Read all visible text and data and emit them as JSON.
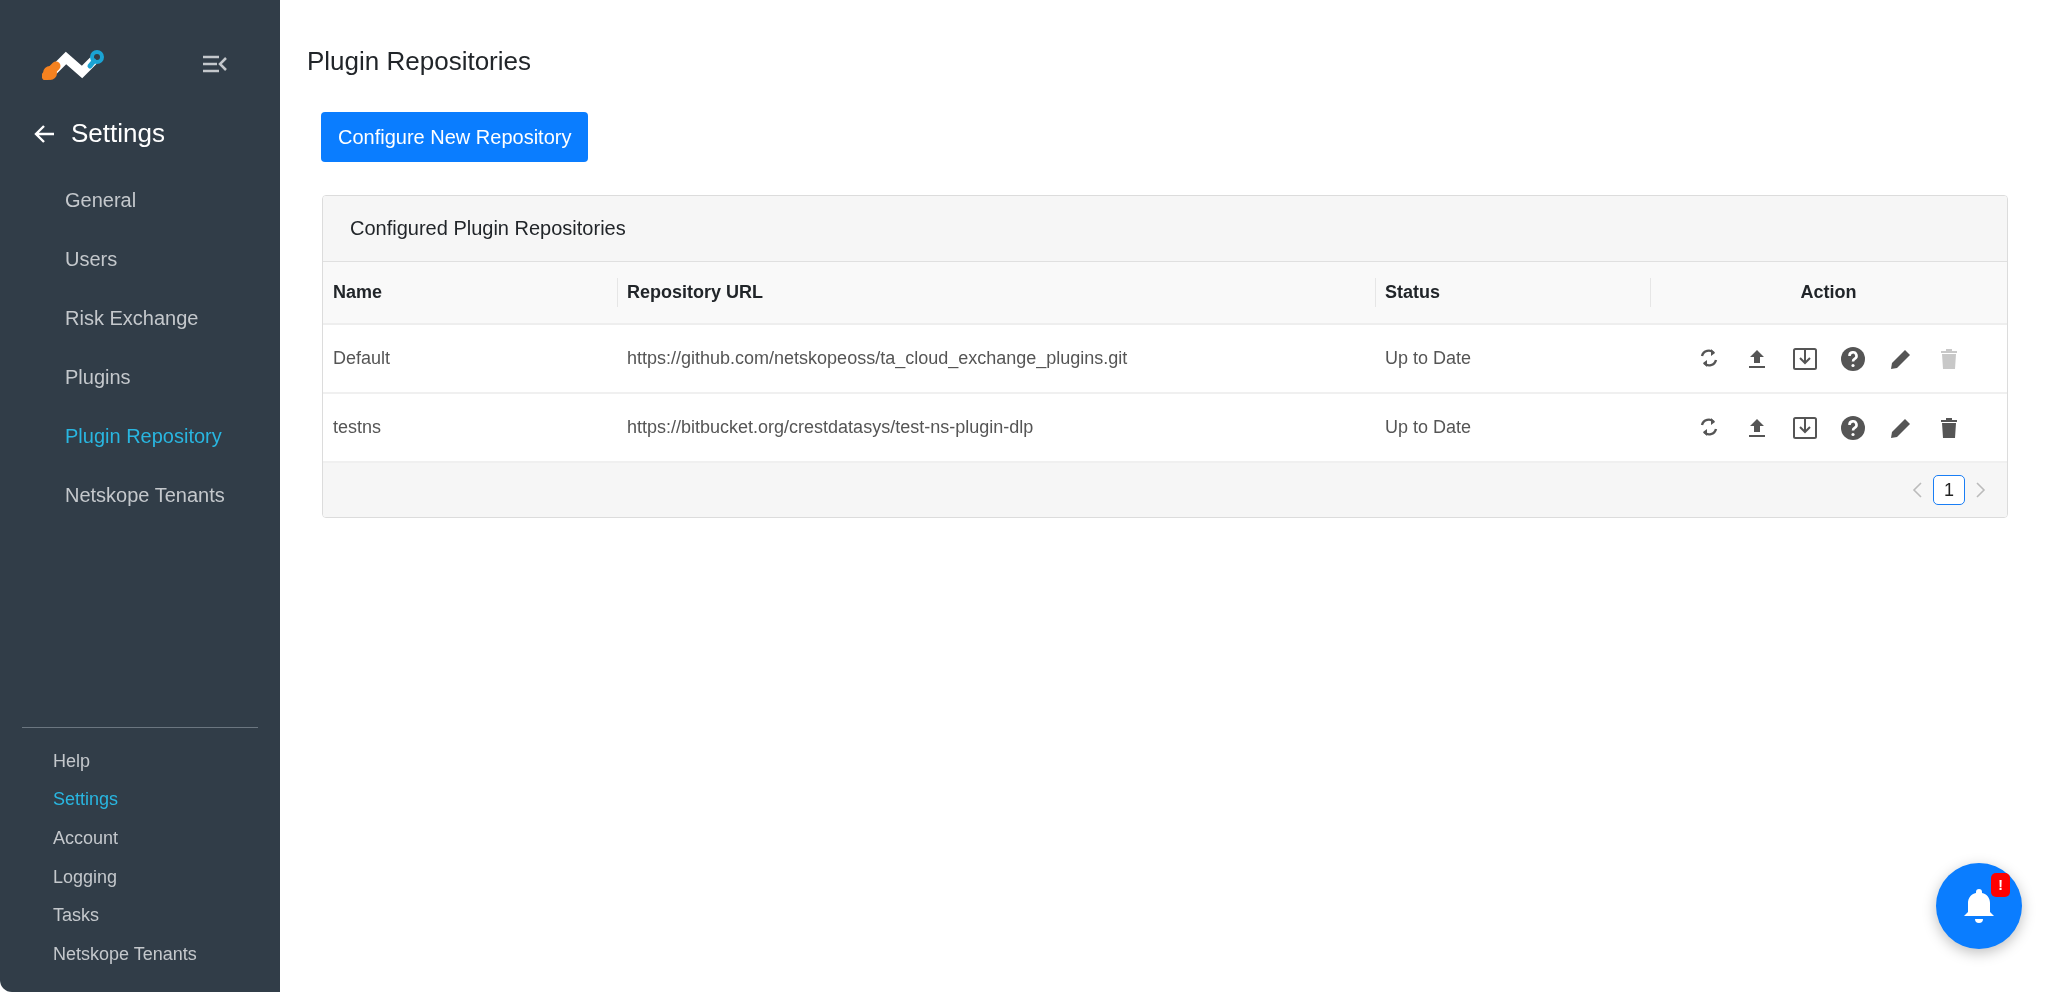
{
  "sidebar": {
    "back_title": "Settings",
    "items": [
      {
        "label": "General",
        "selected": false
      },
      {
        "label": "Users",
        "selected": false
      },
      {
        "label": "Risk Exchange",
        "selected": false
      },
      {
        "label": "Plugins",
        "selected": false
      },
      {
        "label": "Plugin Repository",
        "selected": true
      },
      {
        "label": "Netskope Tenants",
        "selected": false
      }
    ],
    "footer_items": [
      {
        "label": "Help",
        "selected": false
      },
      {
        "label": "Settings",
        "selected": true
      },
      {
        "label": "Account",
        "selected": false
      },
      {
        "label": "Logging",
        "selected": false
      },
      {
        "label": "Tasks",
        "selected": false
      },
      {
        "label": "Netskope Tenants",
        "selected": false
      }
    ]
  },
  "page_title": "Plugin Repositories",
  "primary_button": "Configure New Repository",
  "card": {
    "title": "Configured Plugin Repositories",
    "table": {
      "columns": [
        "Name",
        "Repository URL",
        "Status",
        "Action"
      ],
      "rows": [
        {
          "cells": [
            "Default",
            "https://github.com/netskopeoss/ta_cloud_exchange_plugins.git",
            "Up to Date"
          ],
          "actions": [
            {
              "kind": "sync",
              "disabled": false
            },
            {
              "kind": "upload",
              "disabled": false
            },
            {
              "kind": "download",
              "disabled": false
            },
            {
              "kind": "help",
              "disabled": false
            },
            {
              "kind": "edit",
              "disabled": false
            },
            {
              "kind": "delete",
              "disabled": true
            }
          ]
        },
        {
          "cells": [
            "testns",
            "https://bitbucket.org/crestdatasys/test-ns-plugin-dlp",
            "Up to Date"
          ],
          "actions": [
            {
              "kind": "sync",
              "disabled": false
            },
            {
              "kind": "upload",
              "disabled": false
            },
            {
              "kind": "download",
              "disabled": false
            },
            {
              "kind": "help",
              "disabled": false
            },
            {
              "kind": "edit",
              "disabled": false
            },
            {
              "kind": "delete",
              "disabled": false
            }
          ]
        }
      ]
    },
    "pagination": {
      "pages": [
        {
          "label": "1",
          "selected": true
        }
      ]
    }
  },
  "notification": {
    "badge": "!"
  }
}
